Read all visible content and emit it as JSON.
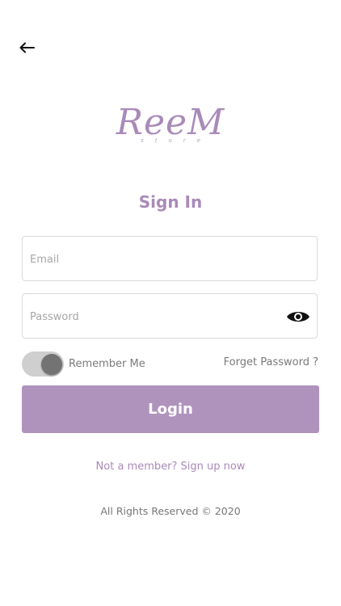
{
  "nav": {
    "back_icon": "arrow-left-icon"
  },
  "logo": {
    "word": "ReeM",
    "sub": "store"
  },
  "title": "Sign In",
  "form": {
    "email_placeholder": "Email",
    "password_placeholder": "Password",
    "eye_icon": "eye-icon",
    "remember_label": "Remember Me",
    "remember_on": true,
    "forget_label": "Forget Password ?",
    "login_label": "Login"
  },
  "signup_text": "Not a member? Sign up now",
  "footer_text": "All Rights Reserved © 2020",
  "colors": {
    "accent": "#b093bd",
    "accent_text": "#a98ab8"
  }
}
